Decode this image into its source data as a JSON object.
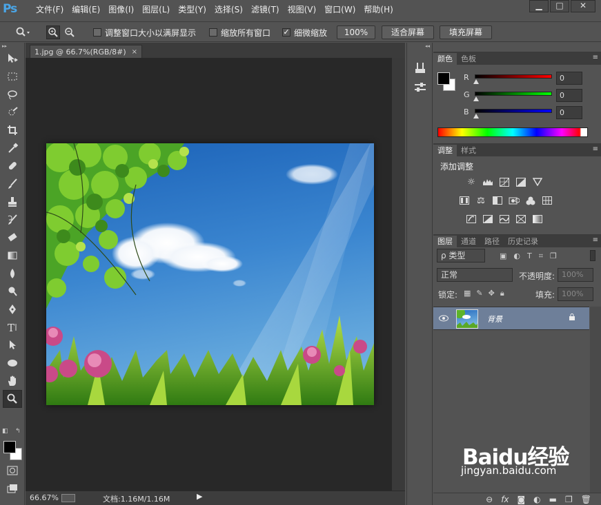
{
  "app": {
    "logo": "Ps"
  },
  "menu": [
    "文件(F)",
    "编辑(E)",
    "图像(I)",
    "图层(L)",
    "类型(Y)",
    "选择(S)",
    "滤镜(T)",
    "视图(V)",
    "窗口(W)",
    "帮助(H)"
  ],
  "window_controls": {
    "minimize": "▁",
    "maximize": "□",
    "close": "✕"
  },
  "options": {
    "resize_windows": {
      "label": "调整窗口大小以满屏显示",
      "checked": false
    },
    "zoom_all": {
      "label": "缩放所有窗口",
      "checked": false
    },
    "scrubby_zoom": {
      "label": "细微缩放",
      "checked": true
    },
    "btn_100": "100%",
    "btn_fit": "适合屏幕",
    "btn_fill": "填充屏幕"
  },
  "document": {
    "tab_title": "1.jpg @ 66.7%(RGB/8#)",
    "tab_close": "×",
    "status_zoom": "66.67%",
    "status_doc": "文档:1.16M/1.16M",
    "status_arrow": "▶"
  },
  "color_panel": {
    "tabs": [
      "颜色",
      "色板"
    ],
    "sliders": [
      {
        "label": "R",
        "value": "0",
        "gradient": "#ff0000"
      },
      {
        "label": "G",
        "value": "0",
        "gradient": "#00ff00"
      },
      {
        "label": "B",
        "value": "0",
        "gradient": "#0000ff"
      }
    ]
  },
  "adjustments_panel": {
    "tabs": [
      "调整",
      "样式"
    ],
    "title": "添加调整"
  },
  "layers_panel": {
    "tabs": [
      "图层",
      "通道",
      "路径",
      "历史记录"
    ],
    "filter_kind": "ρ 类型",
    "blend_mode": "正常",
    "opacity_label": "不透明度:",
    "opacity_value": "100%",
    "lock_label": "锁定:",
    "fill_label": "填充:",
    "fill_value": "100%",
    "layers": [
      {
        "name": "背景",
        "visible": true,
        "locked": true
      }
    ]
  },
  "watermark": {
    "brand": "Baidu经验",
    "url": "jingyan.baidu.com"
  }
}
